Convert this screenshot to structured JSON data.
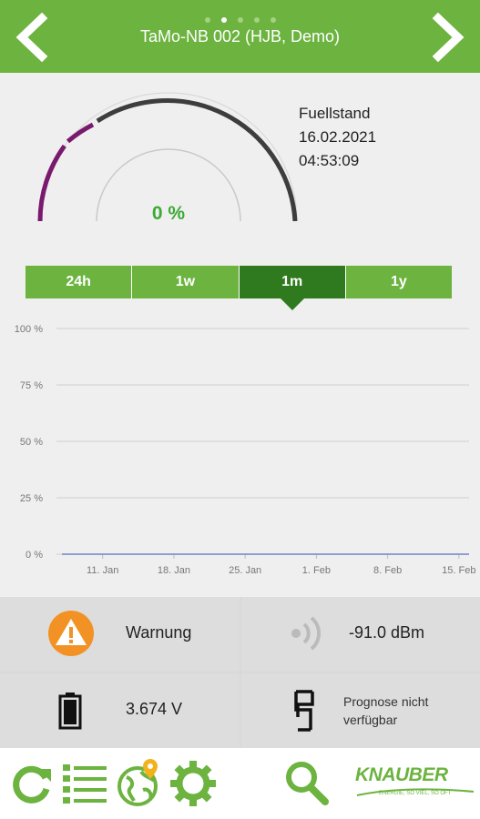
{
  "header": {
    "title": "TaMo-NB 002 (HJB, Demo)",
    "page_count": 5,
    "active_page": 2
  },
  "gauge": {
    "value_label": "0 %",
    "level_percent": 0,
    "info": {
      "label": "Fuellstand",
      "date": "16.02.2021",
      "time": "04:53:09"
    }
  },
  "range_tabs": [
    "24h",
    "1w",
    "1m",
    "1y"
  ],
  "active_range": "1m",
  "chart_data": {
    "type": "line",
    "title": "",
    "xlabel": "",
    "ylabel": "",
    "yticks": [
      "100 %",
      "75 %",
      "50 %",
      "25 %",
      "0 %"
    ],
    "ylim": [
      0,
      100
    ],
    "x_ticks": [
      "11. Jan",
      "18. Jan",
      "25. Jan",
      "1. Feb",
      "8. Feb",
      "15. Feb"
    ],
    "x": [
      "2021-01-07",
      "2021-02-16"
    ],
    "series": [
      {
        "values": [
          0,
          0
        ],
        "color": "#6f86c6"
      }
    ],
    "grid": true,
    "legend": "none"
  },
  "status": {
    "warning_label": "Warnung",
    "signal_value": "-91.0 dBm",
    "battery_value": "3.674 V",
    "prognosis_line1": "Prognose nicht",
    "prognosis_line2": "verfügbar"
  },
  "toolbar": {
    "icons": [
      "refresh-icon",
      "list-icon",
      "map-globe-icon",
      "settings-gear-icon",
      "search-icon"
    ],
    "logo_text": "KNAUBER",
    "logo_sub": "ENERGIE, SO VIEL, SO OFT"
  },
  "colors": {
    "brand_green": "#6cb33f",
    "tab_active": "#2f7a1f",
    "gauge_purple": "#7a1a6e",
    "gauge_dark": "#3d3d3d",
    "warning_orange": "#f29224",
    "value_green": "#3aaa35"
  }
}
